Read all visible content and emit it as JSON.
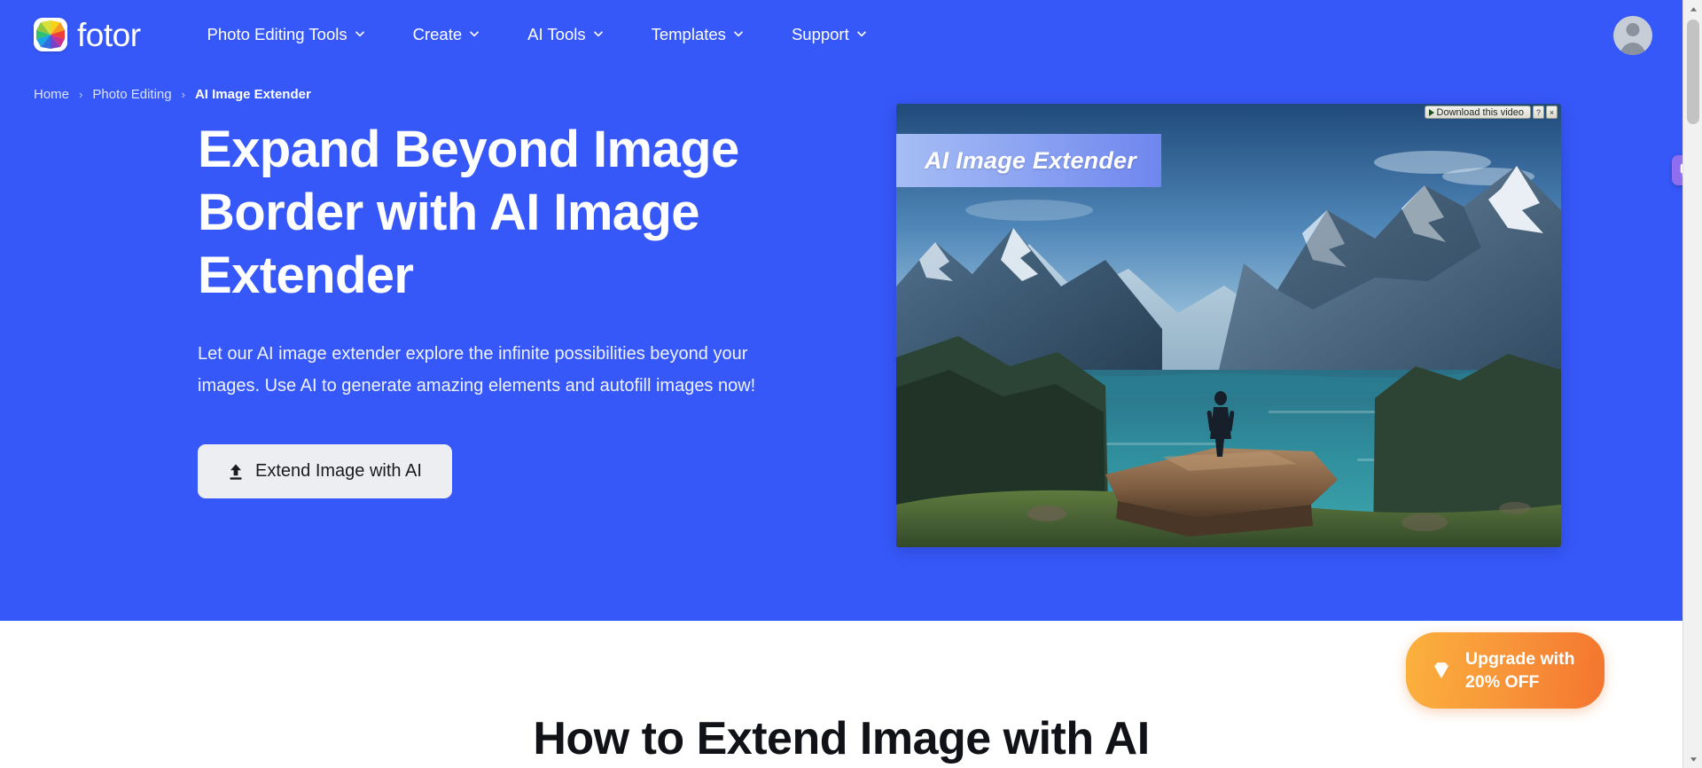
{
  "navbar": {
    "brand": "fotor",
    "brand_logo_icon": "fotor-colorwheel-logo",
    "items": [
      {
        "label": "Photo Editing Tools",
        "icon": "chevron-down-icon"
      },
      {
        "label": "Create",
        "icon": "chevron-down-icon"
      },
      {
        "label": "AI Tools",
        "icon": "chevron-down-icon"
      },
      {
        "label": "Templates",
        "icon": "chevron-down-icon"
      },
      {
        "label": "Support",
        "icon": "chevron-down-icon"
      }
    ],
    "avatar_icon": "user-avatar-icon"
  },
  "breadcrumb": {
    "items": [
      {
        "label": "Home",
        "current": false
      },
      {
        "label": "Photo Editing",
        "current": false
      },
      {
        "label": "AI Image Extender",
        "current": true
      }
    ],
    "separator": "›"
  },
  "hero": {
    "title": "Expand Beyond Image Border with AI Image Extender",
    "subtitle": "Let our AI image extender explore the infinite possibilities beyond your images. Use AI to generate amazing elements and autofill images now!",
    "cta_label": "Extend Image with AI",
    "cta_icon": "upload-arrow-icon",
    "background_color": "#3758f9",
    "media": {
      "overlay_label": "AI Image Extender",
      "alt": "Person standing on rock ledge overlooking a turquoise fjord with snow-capped mountains",
      "download_widget": {
        "label": "Download this video",
        "play_icon": "play-triangle-icon",
        "help_label": "?",
        "close_label": "×"
      }
    }
  },
  "side_tab": {
    "icon": "feedback-bubble-icon",
    "color": "#8f6ef0"
  },
  "upgrade_badge": {
    "line1": "Upgrade with",
    "line2": "20% OFF",
    "icon": "diamond-icon",
    "color": "#f8963a"
  },
  "lower_section": {
    "title": "How to Extend Image with AI"
  },
  "scrollbar": {
    "up_arrow": "▲",
    "down_arrow": "▼"
  }
}
